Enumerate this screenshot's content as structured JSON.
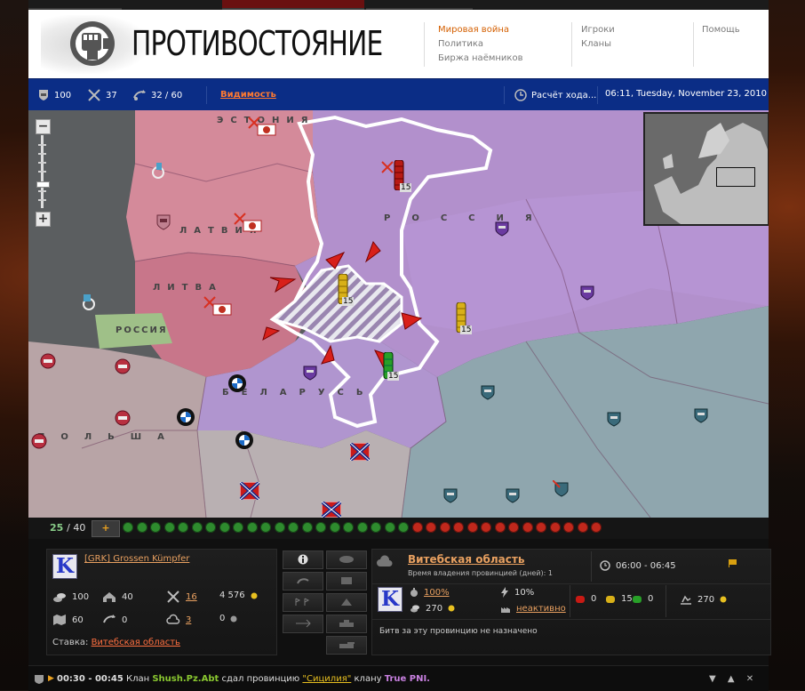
{
  "header": {
    "logo_text": "ПРОТИВОСТОЯНИЕ",
    "nav_col1": [
      "Мировая война",
      "Политика",
      "Биржа наёмников"
    ],
    "nav_col2": [
      "Игроки",
      "Кланы"
    ],
    "nav_col3": [
      "Помощь"
    ]
  },
  "statusbar": {
    "tanks": "100",
    "battles": "37",
    "turns": "32 / 60",
    "visibility_link": "Видимость",
    "calc_label": "Расчёт хода...",
    "datetime": "06:11, Tuesday, November 23, 2010"
  },
  "map": {
    "labels": {
      "estonia": "ЭСТОНИЯ",
      "latvia": "ЛАТВИЯ",
      "lithuania": "ЛИТВА",
      "russia_kal": "РОССИЯ",
      "russia": "РОССИЯ",
      "belarus": "БЕЛАРУСЬ",
      "poland": "ПОЛЬША"
    },
    "army_counts": [
      "15",
      "15",
      "15",
      "15"
    ]
  },
  "turnbar": {
    "used": "25",
    "total": "/ 40",
    "plus": "+",
    "green_dots": 21,
    "red_dots": 14,
    "colors": {
      "green": "#2e8b2e",
      "red": "#c0281c"
    }
  },
  "clan_panel": {
    "clan_name": "[GRK] Grossen Kümpfer",
    "stats": {
      "players": "100",
      "buildings": "40",
      "battles": "16",
      "gold": "4 576",
      "provinces": "60",
      "moves": "0",
      "defeats": "3",
      "other": "0"
    },
    "bet_label": "Ставка:",
    "bet_link": "Витебская область"
  },
  "province_panel": {
    "name": "Витебская область",
    "ownership": "Время владения провинцией (дней): 1",
    "time": "06:00 - 06:45",
    "percent": "100%",
    "income": "270",
    "lightning": "10%",
    "status_link": "неактивно",
    "red_count": "0",
    "yellow_count": "15",
    "green_count": "0",
    "revenue": "270",
    "no_battle": "Битв за эту провинцию не назначено"
  },
  "ticker": {
    "time": "00:30 - 00:45",
    "text1": "Клан",
    "clan1": "Shush.Pz.Abt",
    "text2": "сдал провинцию",
    "province": "\"Сицилия\"",
    "text3": "клану",
    "clan2": "True PNI."
  }
}
